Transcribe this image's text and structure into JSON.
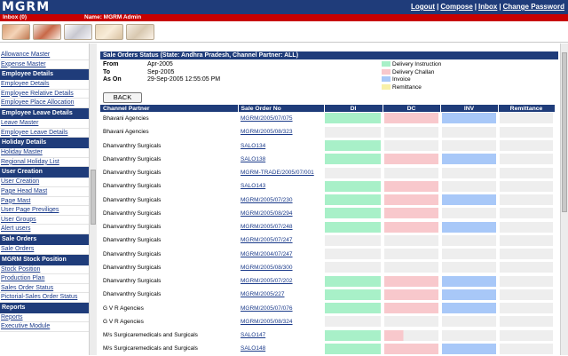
{
  "header": {
    "logo": "MGRM",
    "links": [
      "Logout",
      "Compose",
      "Inbox",
      "Change Password"
    ],
    "inbox": "Inbox  (0)",
    "user": "Name: MGRM Admin"
  },
  "sidebar": {
    "sections": [
      {
        "type": "link",
        "label": "Allowance Master"
      },
      {
        "type": "link",
        "label": "Expense Master"
      },
      {
        "type": "head",
        "label": "Employee Details"
      },
      {
        "type": "link",
        "label": "Employee Details"
      },
      {
        "type": "link",
        "label": "Employee Relative Details"
      },
      {
        "type": "link",
        "label": "Employee Place Allocation"
      },
      {
        "type": "head",
        "label": "Employee Leave Details"
      },
      {
        "type": "link",
        "label": "Leave Master"
      },
      {
        "type": "link",
        "label": "Employee Leave Details"
      },
      {
        "type": "head",
        "label": "Holiday Details"
      },
      {
        "type": "link",
        "label": "Holiday Master"
      },
      {
        "type": "link",
        "label": "Regional Holiday List"
      },
      {
        "type": "head",
        "label": "User Creation"
      },
      {
        "type": "link",
        "label": "User Creation"
      },
      {
        "type": "link",
        "label": "Page Head Mast"
      },
      {
        "type": "link",
        "label": "Page Mast"
      },
      {
        "type": "link",
        "label": "User Page Previliges"
      },
      {
        "type": "link",
        "label": "User Groups"
      },
      {
        "type": "link",
        "label": "Alert users"
      },
      {
        "type": "head",
        "label": "Sale Orders"
      },
      {
        "type": "link",
        "label": "Sale Orders"
      },
      {
        "type": "head",
        "label": "MGRM Stock Position"
      },
      {
        "type": "link",
        "label": "Stock Position"
      },
      {
        "type": "link",
        "label": "Production Plan"
      },
      {
        "type": "link",
        "label": "Sales Order Status"
      },
      {
        "type": "link",
        "label": "Pictorial-Sales Order Status"
      },
      {
        "type": "head",
        "label": "Reports"
      },
      {
        "type": "link",
        "label": "Reports"
      },
      {
        "type": "link",
        "label": "Executive Module"
      }
    ]
  },
  "main": {
    "title": "Sale Orders Status  (State: Andhra Pradesh,  Channel Partner: ALL)",
    "info": [
      {
        "key": "From",
        "value": "Apr-2005"
      },
      {
        "key": "To",
        "value": "Sep-2005"
      },
      {
        "key": "As On",
        "value": "29-Sep-2005 12:55:05 PM"
      }
    ],
    "legend": [
      {
        "label": "Delivery Instruction",
        "color": "#a8f0c8"
      },
      {
        "label": "Delivery Challan",
        "color": "#f8c8cc"
      },
      {
        "label": "Invoice",
        "color": "#a8c8f8"
      },
      {
        "label": "Remittance",
        "color": "#f8f0a8"
      }
    ],
    "back_label": "BACK",
    "columns": [
      "Channel Partner",
      "Sale Order No",
      "DI",
      "DC",
      "INV",
      "Remittance"
    ],
    "rows": [
      {
        "partner": "Bhavani Agencies",
        "so": "MGRM/2005/07/075",
        "di": true,
        "dc": true,
        "inv": true,
        "rem": false
      },
      {
        "partner": "Bhavani Agencies",
        "so": "MGRM/2005/08/323",
        "di": false,
        "dc": false,
        "inv": false,
        "rem": false
      },
      {
        "partner": "Dhanvanthry Surgicals",
        "so": "SALO134",
        "di": true,
        "dc": false,
        "inv": false,
        "rem": false
      },
      {
        "partner": "Dhanvanthry Surgicals",
        "so": "SALO138",
        "di": true,
        "dc": true,
        "inv": true,
        "rem": false
      },
      {
        "partner": "Dhanvanthry Surgicals",
        "so": "MGRM-TRADE/2005/07/001",
        "di": false,
        "dc": false,
        "inv": false,
        "rem": false
      },
      {
        "partner": "Dhanvanthry Surgicals",
        "so": "SALO143",
        "di": true,
        "dc": true,
        "inv": false,
        "rem": false
      },
      {
        "partner": "Dhanvanthry Surgicals",
        "so": "MGRM/2005/07/230",
        "di": true,
        "dc": true,
        "inv": true,
        "rem": false
      },
      {
        "partner": "Dhanvanthry Surgicals",
        "so": "MGRM/2005/08/294",
        "di": true,
        "dc": true,
        "inv": false,
        "rem": false
      },
      {
        "partner": "Dhanvanthry Surgicals",
        "so": "MGRM/2005/07/248",
        "di": true,
        "dc": true,
        "inv": true,
        "rem": false
      },
      {
        "partner": "Dhanvanthry Surgicals",
        "so": "MGRM/2005/07/247",
        "di": false,
        "dc": false,
        "inv": false,
        "rem": false
      },
      {
        "partner": "Dhanvanthry Surgicals",
        "so": "MGRM/2004/07/247",
        "di": false,
        "dc": false,
        "inv": false,
        "rem": false
      },
      {
        "partner": "Dhanvanthry Surgicals",
        "so": "MGRM/2005/08/300",
        "di": false,
        "dc": false,
        "inv": false,
        "rem": false
      },
      {
        "partner": "Dhanvanthry Surgicals",
        "so": "MGRM/2005/07/202",
        "di": true,
        "dc": true,
        "inv": true,
        "rem": false
      },
      {
        "partner": "Dhanvanthry Surgicals",
        "so": "MGRM/2005/227",
        "di": true,
        "dc": true,
        "inv": true,
        "rem": false
      },
      {
        "partner": "G V R Agencies",
        "so": "MGRM/2005/07/076",
        "di": true,
        "dc": true,
        "inv": true,
        "rem": false
      },
      {
        "partner": "G V R Agencies",
        "so": "MGRM/2005/08/324",
        "di": false,
        "dc": false,
        "inv": false,
        "rem": false
      },
      {
        "partner": "M/s Surgicaremedicals and Surgicals",
        "so": "SALO147",
        "di": true,
        "dc": "partial",
        "inv": false,
        "rem": false
      },
      {
        "partner": "M/s Surgicaremedicals and Surgicals",
        "so": "SALO148",
        "di": true,
        "dc": true,
        "inv": true,
        "rem": false
      }
    ]
  },
  "colors": {
    "navy": "#1f3c7a",
    "red": "#c80000",
    "di": "#a8f0c8",
    "dc": "#f8c8cc",
    "inv": "#a8c8f8",
    "rem": "#f8f0a8",
    "empty": "#eeeeee"
  }
}
